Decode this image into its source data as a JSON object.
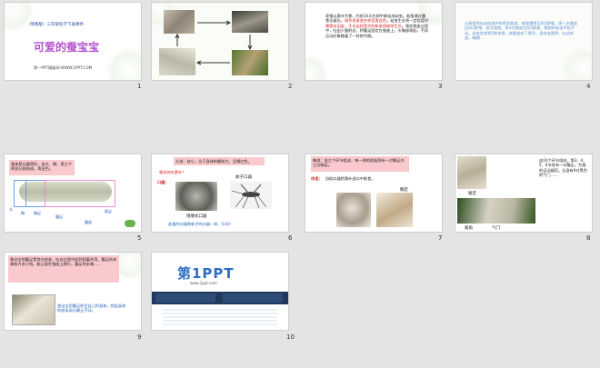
{
  "slides": [
    {
      "num": "1",
      "publisher": "（鄂教版）三年级科学下册课件",
      "title": "可爱的蚕宝宝",
      "footer": "第一PPT模板网-WWW.1PPT.COM"
    },
    {
      "num": "2"
    },
    {
      "num": "3",
      "text_plain1": "家蚕以桑叶为食，约经10天在卵中孵化成幼虫。蚁蚕通过摄食迅速长，",
      "text_red1": "体色逐渐变灰转呈青白色",
      "text_plain2": "。幼虫生长到一定程度时",
      "text_red2": "需脱去旧皮，生长出较宽大的新皮再继续生长",
      "text_plain3": "。蚕在脱皮过程中，吐出少量的丝，将腹足固定在蚕座上，头胸部昂起，不再运动好象睡着了一样称为眠。"
    },
    {
      "num": "4",
      "text": "从蚁蚕到吐丝结茧共有四次蜕皮，蚁蚕摄食后叫1龄蚕，第一次脱皮后叫2龄蚕，依次类推，第4次脱皮后叫5龄蚕，眠前的幼虫不吃不动。幼虫发育到5龄末期，体躯变成了黄色，身体变透明，吐丝结茧，蛹期…"
    },
    {
      "num": "5",
      "text": "蚕体是长圆筒形，由头、胸、第三个明显分段构成，青白色。",
      "labels": {
        "head": "头",
        "chest": "胸",
        "abdomen": "腹部",
        "chest_feet": "胸足",
        "belly_feet": "腹足",
        "tail_feet": "尾足"
      }
    },
    {
      "num": "6",
      "banner": "头部：较小，位于身体的最前方，呈褐红色。",
      "question1": "蚕如何吃桑叶？",
      "mouth_label": "口器：",
      "mosquito_label": "蚊子口器",
      "chewing_label": "咀嚼式口器",
      "question2": "若蚕的口器和蚊子的口器一样，行吗？"
    },
    {
      "num": "7",
      "banner": "胸部：由三个环节组成，每一侧的前面两有一对胸足共三对胸足。",
      "function_label": "作用：",
      "function_text": "协助口器把桑叶送口中取食。",
      "foot_label": "胸足"
    },
    {
      "num": "8",
      "text": "由10个环节组成，第3、4、5、6节各有一对腹足。为蚕的运动器官。全身有9对黑色的气门……",
      "labels": {
        "tail_feet": "尾足",
        "tail_horn": "尾角",
        "spiracle": "气门"
      }
    },
    {
      "num": "9",
      "text": "蚕宝宝的腹足是其在结茧、吐丝过程中起到固着作用，腹足的末端有许多小钩。能让蚕在蚕座上爬行，腹足的末端……",
      "caption": "蚕宝宝用腹足抓住自己的身体，抬起身体的前半部分静止不动。"
    },
    {
      "num": "10",
      "logo": "第1PPT",
      "url": "www.1ppt.com"
    }
  ]
}
